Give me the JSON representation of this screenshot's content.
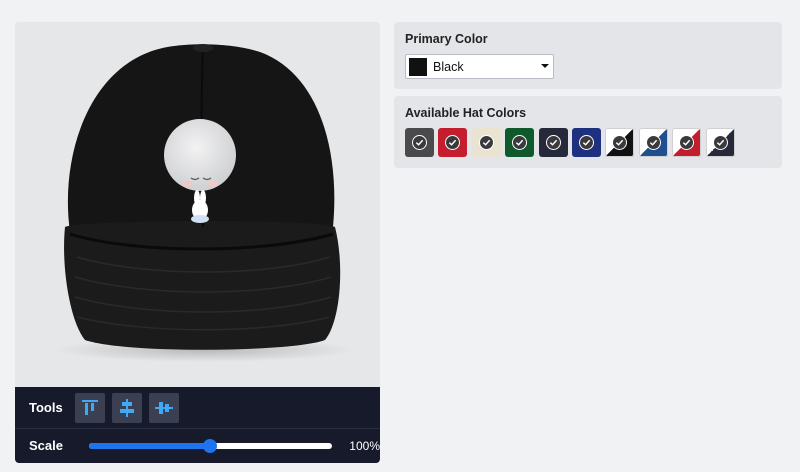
{
  "preview": {
    "design_description": "moon and rabbit design on hat"
  },
  "toolbar": {
    "tools_label": "Tools",
    "tools": [
      {
        "icon": "align-top-icon"
      },
      {
        "icon": "align-center-vertical-icon"
      },
      {
        "icon": "align-center-horizontal-icon"
      }
    ],
    "scale_label": "Scale",
    "scale_value": "100%",
    "scale_fraction": 0.5
  },
  "primary_color": {
    "title": "Primary Color",
    "selected": "Black",
    "selected_hex": "#111111"
  },
  "hat_colors": {
    "title": "Available Hat Colors",
    "swatches": [
      {
        "colors": [
          "#4a4a4c",
          "#4a4a4c"
        ]
      },
      {
        "colors": [
          "#c41e2e",
          "#c41e2e"
        ]
      },
      {
        "colors": [
          "#ebe3d2",
          "#ebe3d2"
        ]
      },
      {
        "colors": [
          "#0f5a2c",
          "#0f5a2c"
        ]
      },
      {
        "colors": [
          "#26293a",
          "#26293a"
        ]
      },
      {
        "colors": [
          "#1d3180",
          "#1d3180"
        ]
      },
      {
        "colors": [
          "#111111",
          "#ffffff"
        ]
      },
      {
        "colors": [
          "#1f4f8f",
          "#ffffff"
        ]
      },
      {
        "colors": [
          "#c41e2e",
          "#ffffff"
        ]
      },
      {
        "colors": [
          "#26293a",
          "#ffffff"
        ]
      }
    ]
  }
}
